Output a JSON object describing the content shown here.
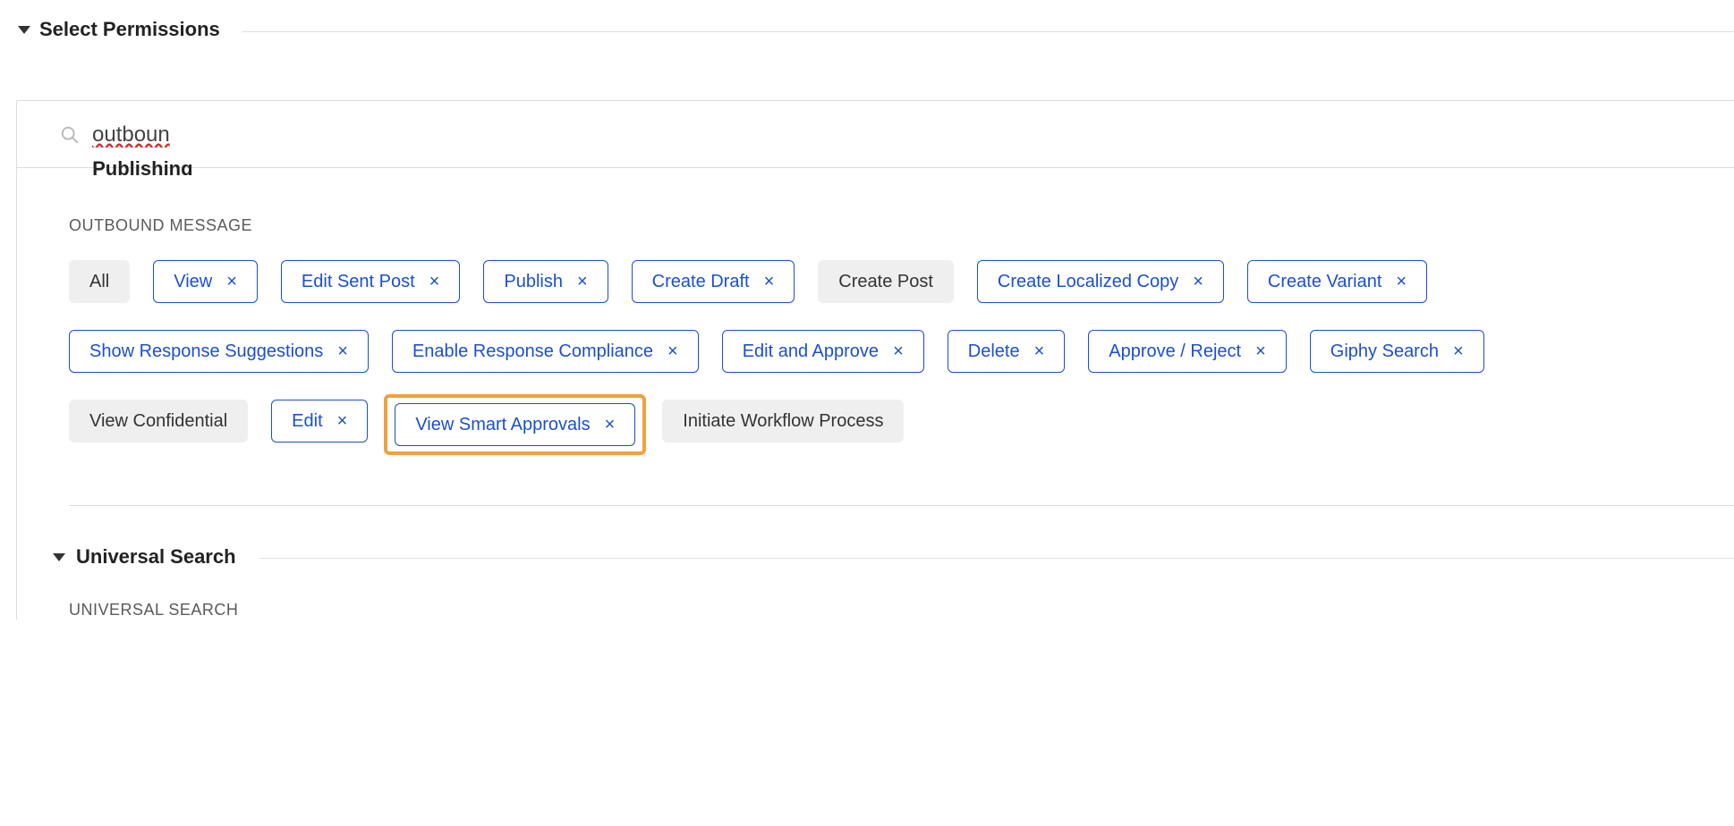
{
  "header": {
    "title": "Select Permissions"
  },
  "search": {
    "value": "outboun"
  },
  "sections": {
    "publishing": {
      "title": "Publishing",
      "group_label": "OUTBOUND MESSAGE",
      "chips": [
        {
          "label": "All",
          "selected": false
        },
        {
          "label": "View",
          "selected": true
        },
        {
          "label": "Edit Sent Post",
          "selected": true
        },
        {
          "label": "Publish",
          "selected": true
        },
        {
          "label": "Create Draft",
          "selected": true
        },
        {
          "label": "Create Post",
          "selected": false
        },
        {
          "label": "Create Localized Copy",
          "selected": true
        },
        {
          "label": "Create Variant",
          "selected": true
        },
        {
          "label": "Show Response Suggestions",
          "selected": true
        },
        {
          "label": "Enable Response Compliance",
          "selected": true
        },
        {
          "label": "Edit and Approve",
          "selected": true
        },
        {
          "label": "Delete",
          "selected": true
        },
        {
          "label": "Approve / Reject",
          "selected": true
        },
        {
          "label": "Giphy Search",
          "selected": true
        },
        {
          "label": "View Confidential",
          "selected": false
        },
        {
          "label": "Edit",
          "selected": true
        },
        {
          "label": "View Smart Approvals",
          "selected": true,
          "highlight": true
        },
        {
          "label": "Initiate Workflow Process",
          "selected": false
        }
      ]
    },
    "universal_search": {
      "title": "Universal Search",
      "group_label": "UNIVERSAL SEARCH"
    }
  },
  "glyphs": {
    "close": "×"
  }
}
